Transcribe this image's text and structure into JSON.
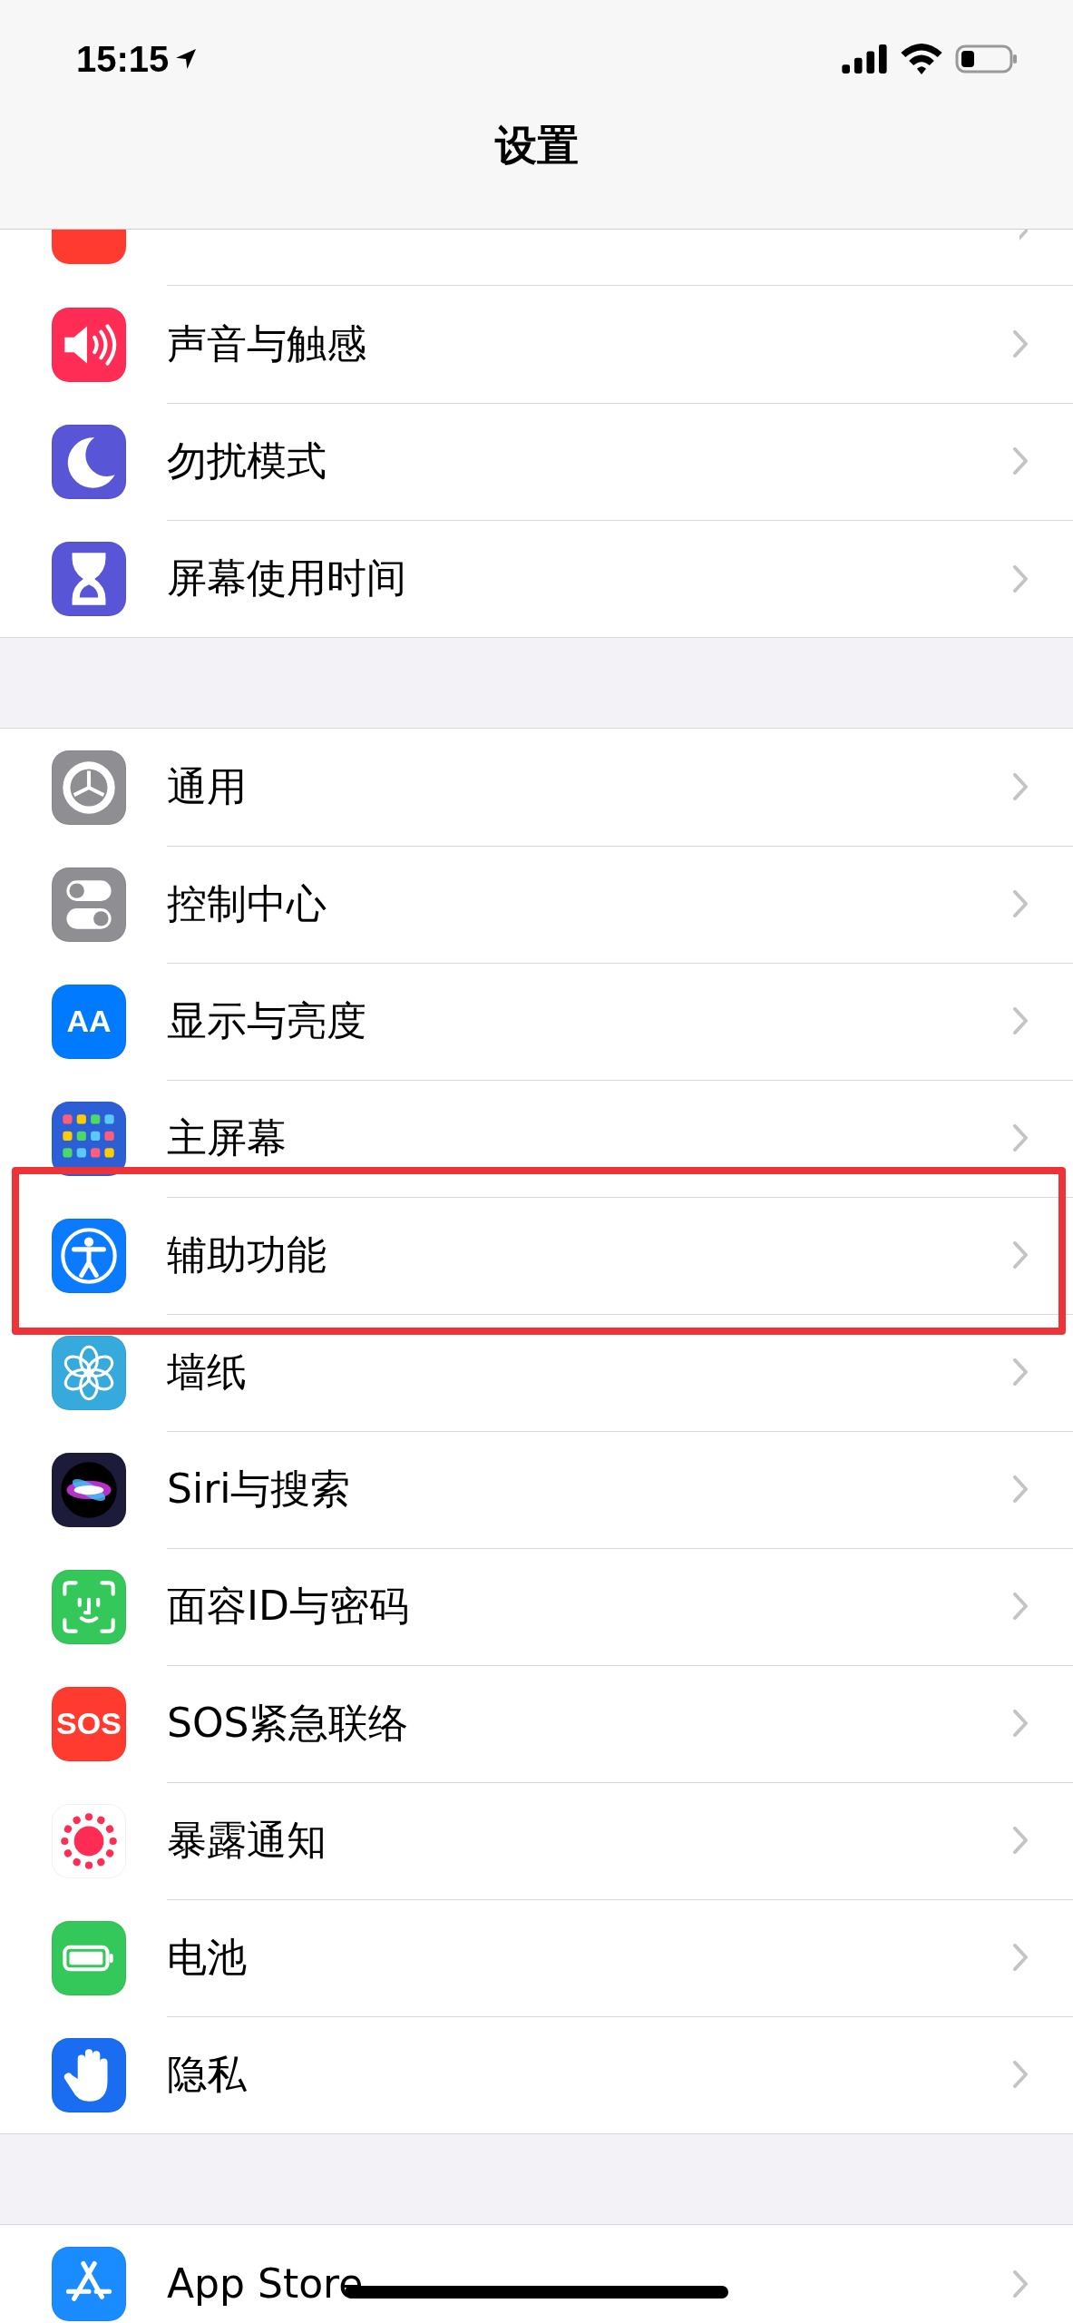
{
  "status_bar": {
    "time": "15:15"
  },
  "nav": {
    "title": "设置"
  },
  "groups": [
    {
      "cut_top_item": {
        "color": "#ff3b30"
      },
      "items": [
        {
          "label": "声音与触感",
          "kind": "speaker",
          "color": "#ff2d55",
          "highlighted": false
        },
        {
          "label": "勿扰模式",
          "kind": "moon",
          "color": "#5856d6",
          "highlighted": false
        },
        {
          "label": "屏幕使用时间",
          "kind": "hourglass",
          "color": "#5856d6",
          "highlighted": false
        }
      ]
    },
    {
      "items": [
        {
          "label": "通用",
          "kind": "gear",
          "color": "#8e8e93",
          "highlighted": false
        },
        {
          "label": "控制中心",
          "kind": "toggles",
          "color": "#8e8e93",
          "highlighted": false
        },
        {
          "label": "显示与亮度",
          "kind": "text",
          "icon_text": "AA",
          "color": "#007aff",
          "highlighted": false
        },
        {
          "label": "主屏幕",
          "kind": "grid",
          "color": "#2c5fd6",
          "highlighted": false
        },
        {
          "label": "辅助功能",
          "kind": "accessibility",
          "color": "#0a7aff",
          "highlighted": true
        },
        {
          "label": "墙纸",
          "kind": "flower",
          "color": "#36aadc",
          "highlighted": false
        },
        {
          "label": "Siri与搜索",
          "kind": "siri",
          "color": "#1c1c3a",
          "highlighted": false
        },
        {
          "label": "面容ID与密码",
          "kind": "face",
          "color": "#34c759",
          "highlighted": false
        },
        {
          "label": "SOS紧急联络",
          "kind": "text",
          "icon_text": "SOS",
          "color": "#ff3b30",
          "highlighted": false
        },
        {
          "label": "暴露通知",
          "kind": "dots",
          "color": "#ffffff",
          "highlighted": false
        },
        {
          "label": "电池",
          "kind": "battery",
          "color": "#34c759",
          "highlighted": false
        },
        {
          "label": "隐私",
          "kind": "hand",
          "color": "#1a6cf0",
          "highlighted": false
        }
      ]
    },
    {
      "items": [
        {
          "label": "App Store",
          "kind": "appstore",
          "color": "#1a8cff",
          "highlighted": false
        }
      ]
    }
  ]
}
